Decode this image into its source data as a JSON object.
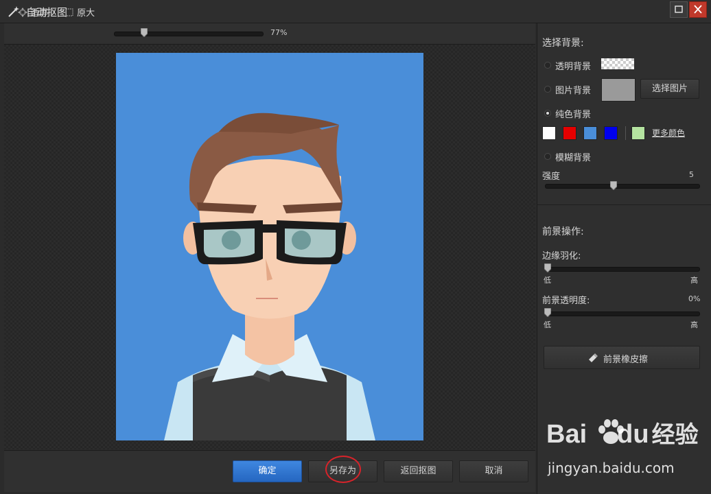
{
  "window": {
    "title": "自动抠图"
  },
  "toolbar": {
    "fit_label": "适屏",
    "original_label": "原大",
    "zoom_value": "77%",
    "zoom_level": 0.77
  },
  "right": {
    "bg_heading": "选择背景:",
    "transparent_label": "透明背景",
    "image_bg_label": "图片背景",
    "choose_image_label": "选择图片",
    "solid_label": "纯色背景",
    "more_colors_label": "更多颜色",
    "swatches": [
      "#ffffff",
      "#e60000",
      "#4a8ed9",
      "#0000ee",
      "#b4e3a0"
    ],
    "blur_label": "模糊背景",
    "strength_label": "强度",
    "strength_value": "5",
    "fg_heading": "前景操作:",
    "feather_label": "边缘羽化:",
    "low_label": "低",
    "high_label": "高",
    "opacity_label": "前景透明度:",
    "opacity_value": "0%",
    "eraser_label": "前景橡皮擦"
  },
  "buttons": {
    "confirm": "确定",
    "save_as": "另存为",
    "back": "返回抠图",
    "cancel": "取消"
  },
  "colors": {
    "accent": "#2f78d6",
    "photo_bg": "#4a8ed9",
    "highlight": "#d8232a"
  },
  "watermark": {
    "brand": "Bai",
    "brand2": "du",
    "suffix": "经验",
    "url": "jingyan.baidu.com"
  }
}
